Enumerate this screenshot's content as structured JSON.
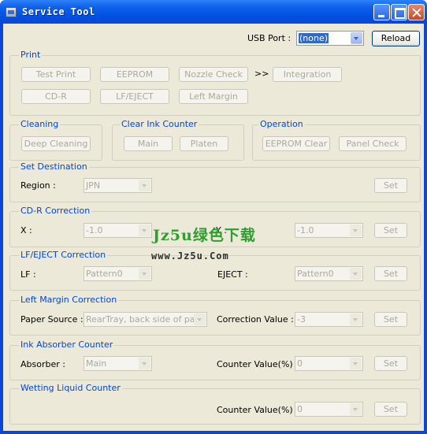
{
  "window": {
    "title": "Service Tool"
  },
  "usb": {
    "label": "USB Port :",
    "value": "(none)",
    "reload": "Reload"
  },
  "print": {
    "legend": "Print",
    "test_print": "Test Print",
    "eeprom": "EEPROM",
    "nozzle_check": "Nozzle Check",
    "arrow": ">>",
    "integration": "Integration",
    "cd_r": "CD-R",
    "lf_eject": "LF/EJECT",
    "left_margin": "Left Margin"
  },
  "cleaning": {
    "legend": "Cleaning",
    "deep": "Deep Cleaning"
  },
  "clear_ink": {
    "legend": "Clear Ink Counter",
    "main": "Main",
    "platen": "Platen"
  },
  "operation": {
    "legend": "Operation",
    "eeprom_clear": "EEPROM Clear",
    "panel_check": "Panel Check"
  },
  "destination": {
    "legend": "Set Destination",
    "region_label": "Region :",
    "region_value": "JPN",
    "set": "Set"
  },
  "cdr_correction": {
    "legend": "CD-R Correction",
    "x_label": "X :",
    "x_value": "-1.0",
    "y_label": "Y :",
    "y_value": "-1.0",
    "set": "Set"
  },
  "lf_eject": {
    "legend": "LF/EJECT Correction",
    "lf_label": "LF :",
    "lf_value": "Pattern0",
    "eject_label": "EJECT :",
    "eject_value": "Pattern0",
    "set": "Set"
  },
  "left_margin": {
    "legend": "Left Margin Correction",
    "source_label": "Paper Source :",
    "source_value": "RearTray, back side of pap",
    "corr_label": "Correction Value :",
    "corr_value": "-3",
    "set": "Set"
  },
  "ink_absorber": {
    "legend": "Ink Absorber Counter",
    "absorber_label": "Absorber :",
    "absorber_value": "Main",
    "counter_label": "Counter Value(%) :",
    "counter_value": "0",
    "set": "Set"
  },
  "wetting": {
    "legend": "Wetting Liquid Counter",
    "counter_label": "Counter Value(%) :",
    "counter_value": "0",
    "set": "Set"
  },
  "watermark": {
    "line1": "Jz5u绿色下载",
    "line2": "www.Jz5u.Com"
  },
  "colors": {
    "accent": "#0046d5",
    "title_bar": "#0a46d8",
    "face": "#ece9d8"
  }
}
